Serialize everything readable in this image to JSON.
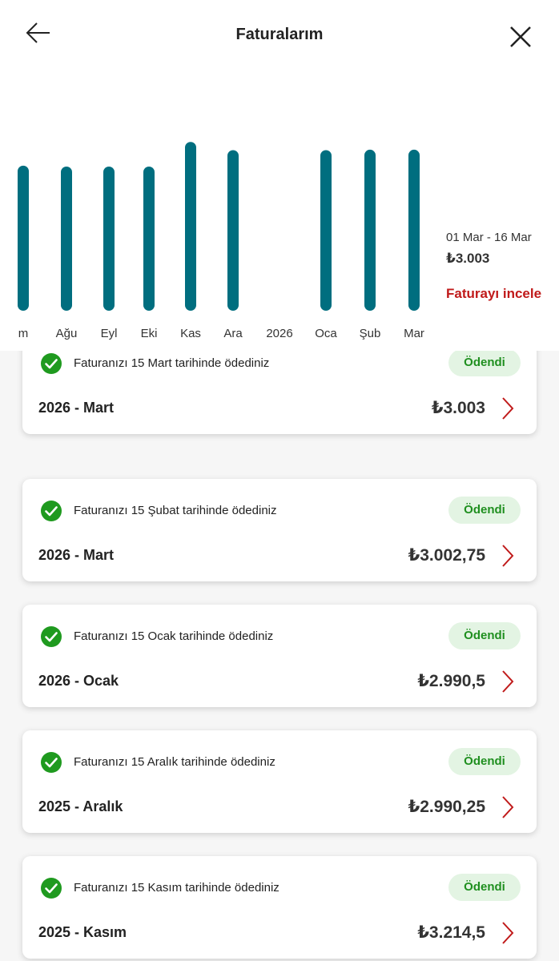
{
  "header": {
    "title": "Faturalarım"
  },
  "chart_data": {
    "type": "bar",
    "title": "",
    "xlabel": "",
    "ylabel": "",
    "categories": [
      "m",
      "Ağu",
      "Eyl",
      "Eki",
      "Kas",
      "Ara",
      "2026",
      "Oca",
      "Şub",
      "Mar"
    ],
    "values": [
      2940,
      2930,
      2930,
      2930,
      3214.5,
      3120,
      null,
      3120,
      3125,
      3125
    ],
    "ylim": [
      1800,
      3300
    ],
    "grid": false,
    "bar_color": "#006e7f"
  },
  "selected": {
    "period": "01 Mar - 16 Mar",
    "amount": "₺3.003",
    "action": "Faturayı incele"
  },
  "bills": [
    {
      "message": "Faturanızı 15 Mart tarihinde ödediniz",
      "status": "Ödendi",
      "period": "2026 - Mart",
      "amount": "₺3.003"
    },
    {
      "message": "Faturanızı 15 Şubat tarihinde ödediniz",
      "status": "Ödendi",
      "period": "2026 - Mart",
      "amount": "₺3.002,75"
    },
    {
      "message": "Faturanızı 15 Ocak tarihinde ödediniz",
      "status": "Ödendi",
      "period": "2026 - Ocak",
      "amount": "₺2.990,5"
    },
    {
      "message": "Faturanızı 15 Aralık tarihinde ödediniz",
      "status": "Ödendi",
      "period": "2025 - Aralık",
      "amount": "₺2.990,25"
    },
    {
      "message": "Faturanızı 15 Kasım tarihinde ödediniz",
      "status": "Ödendi",
      "period": "2025 - Kasım",
      "amount": "₺3.214,5"
    }
  ],
  "colors": {
    "accent_red": "#c01a1a",
    "success_green": "#1f9a1f",
    "badge_bg": "#e3f4e3",
    "bar": "#006e7f"
  },
  "icons": {
    "back": "arrow-left-icon",
    "close": "close-icon",
    "check": "check-circle-icon",
    "chevron": "chevron-right-icon"
  }
}
